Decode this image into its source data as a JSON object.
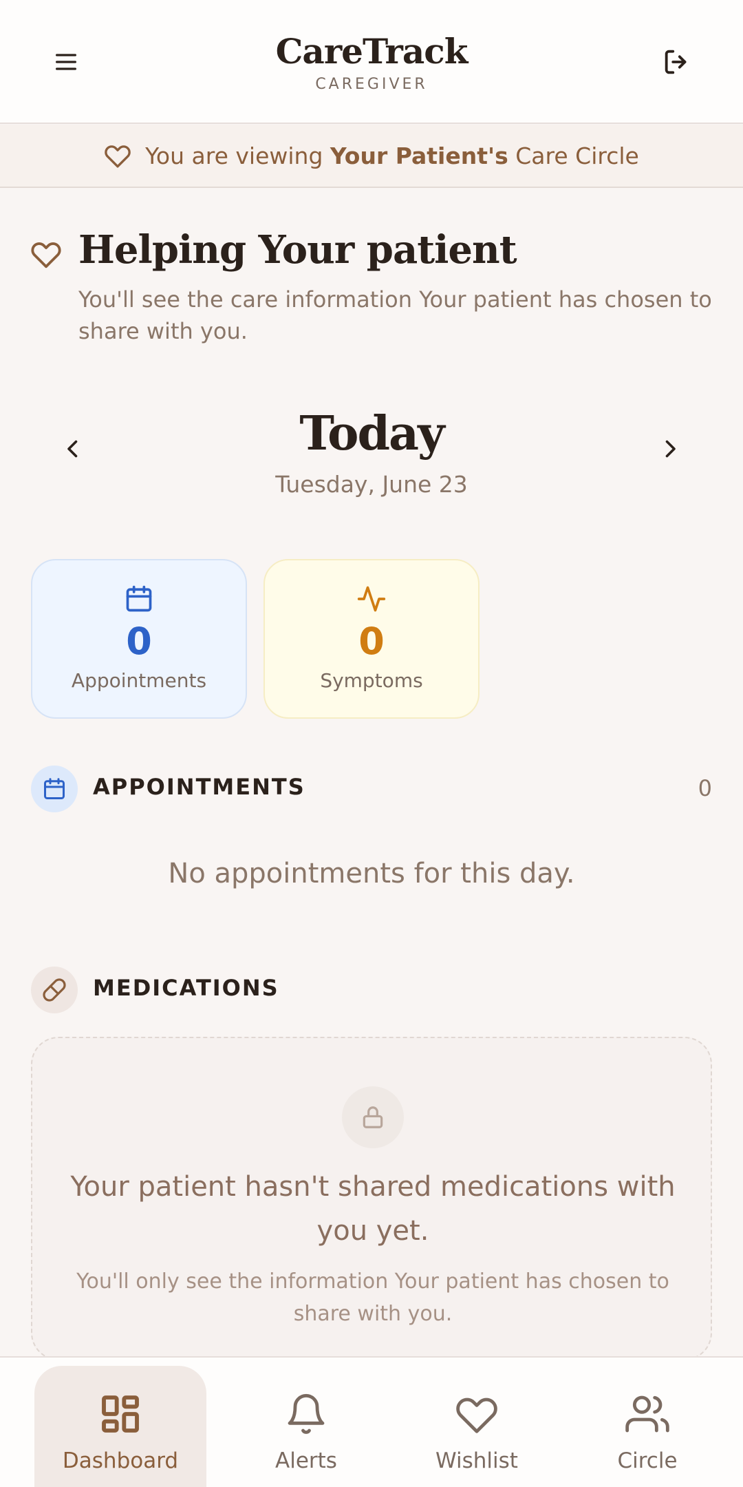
{
  "header": {
    "title": "CareTrack",
    "subtitle": "CAREGIVER",
    "menu_icon": "hamburger-menu-icon",
    "logout_icon": "logout-icon"
  },
  "banner": {
    "prefix": "You are viewing",
    "name": "Your Patient's",
    "suffix": "Care Circle",
    "icon": "heart-icon"
  },
  "helping": {
    "title": "Helping Your patient",
    "description": "You'll see the care information Your patient has chosen to share with you."
  },
  "day": {
    "title": "Today",
    "date": "Tuesday, June 23"
  },
  "stats": [
    {
      "label": "Appointments",
      "value": "0",
      "icon": "calendar-icon",
      "color": "#2d62c8"
    },
    {
      "label": "Symptoms",
      "value": "0",
      "icon": "activity-icon",
      "color": "#d07d12"
    }
  ],
  "appointments": {
    "title": "APPOINTMENTS",
    "count": "0",
    "empty": "No appointments for this day."
  },
  "medications": {
    "title": "MEDICATIONS",
    "locked_title": "Your patient hasn't shared medications with you yet.",
    "locked_sub": "You'll only see the information Your patient has chosen to share with you."
  },
  "nav": [
    {
      "label": "Dashboard",
      "icon": "dashboard-icon",
      "active": true
    },
    {
      "label": "Alerts",
      "icon": "bell-icon",
      "active": false
    },
    {
      "label": "Wishlist",
      "icon": "heart-icon",
      "active": false
    },
    {
      "label": "Circle",
      "icon": "users-icon",
      "active": false
    }
  ],
  "colors": {
    "accent": "#8a5e3b",
    "background": "#f9f5f3",
    "appointment_blue": "#2d62c8",
    "symptom_orange": "#d07d12"
  }
}
